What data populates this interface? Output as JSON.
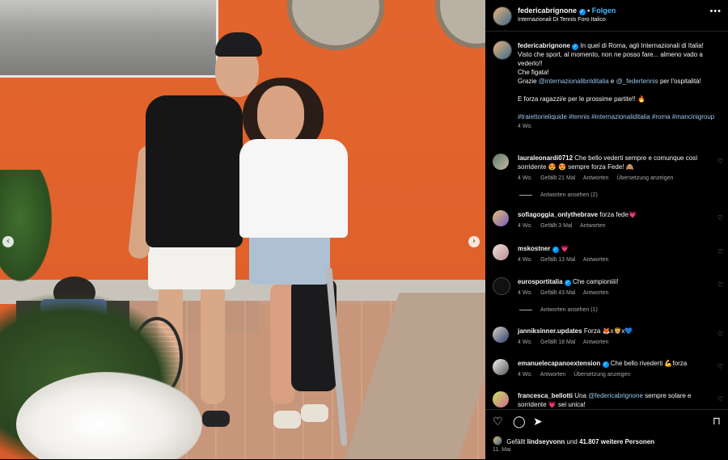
{
  "header": {
    "username": "federicabrignone",
    "follow_label": "Folgen",
    "location": "Internazionali Di Tennis Foro Italico",
    "more_icon": "more-icon"
  },
  "caption": {
    "username": "federicabrignone",
    "line1": "In quel di Roma, agli Internazionali di Italia!",
    "line2": "Visto che sport, al momento, non ne posso fare... almeno vado a vederlo!!",
    "line3": "Che figata!",
    "thanks_prefix": "Grazie",
    "mention1": "@internazionalibnlditalia",
    "and": "e",
    "mention2": "@_federtennis",
    "thanks_suffix": "per l'ospitalità!",
    "line5": "E forza ragazzi/e per le prossime partite!! 🔥",
    "hashtags": "#traiettorieliquide #tennis #internazionaliditalia #roma #mancinigroup",
    "time": "4 Wo."
  },
  "comments": [
    {
      "username": "lauraleonardi0712",
      "text": "Che bello vederti sempre e comunque così sorridente 😍 😍 sempre forza Fede! 🙈",
      "time": "4 Wo.",
      "likes": "Gefällt 21 Mal",
      "reply": "Antworten",
      "extra": "Übersetzung anzeigen",
      "replies": "Antworten ansehen (2)"
    },
    {
      "username": "sofiagoggia_onlythebrave",
      "text": "forza fede💗",
      "time": "4 Wo.",
      "likes": "Gefällt 3 Mal",
      "reply": "Antworten"
    },
    {
      "username": "mskostner",
      "text": "💗",
      "time": "4 Wo.",
      "likes": "Gefällt 13 Mal",
      "reply": "Antworten"
    },
    {
      "username": "eurosportitalia",
      "text": "Che campioniiii!",
      "time": "4 Wo.",
      "likes": "Gefällt 43 Mal",
      "reply": "Antworten",
      "replies": "Antworten ansehen (1)"
    },
    {
      "username": "janniksinner.updates",
      "text": "Forza 🦊x🦁x💙",
      "time": "4 Wo.",
      "likes": "Gefällt 18 Mal",
      "reply": "Antworten"
    },
    {
      "username": "emanuelecapanoextension",
      "text": "Che bello rivederti 💪forza",
      "time": "4 Wo.",
      "reply": "Antworten",
      "extra": "Übersetzung anzeigen"
    },
    {
      "username": "francesca_bellotti",
      "text_pre": "Una",
      "mention": "@federicabrignone",
      "text_post": "sempre solare e sorridente 💗 sei unica!"
    }
  ],
  "footer": {
    "liked_prefix": "Gefällt",
    "liked_user": "lindseyvonn",
    "liked_mid": "und",
    "liked_count": "41.807 weitere Personen",
    "date": "11. Mai"
  },
  "colors": {
    "accent": "#0095f6",
    "follow": "#4cb5f9",
    "wall": "#e1612b"
  }
}
